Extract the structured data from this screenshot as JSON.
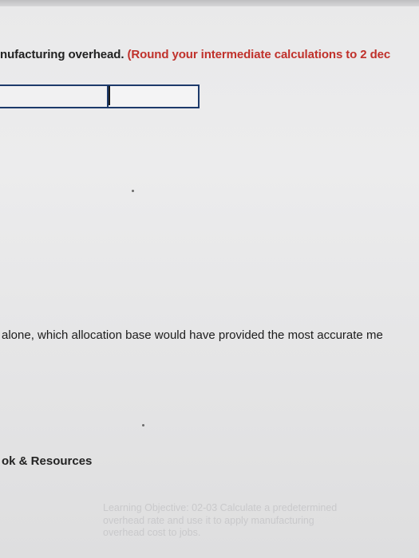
{
  "question": {
    "text_plain": "nufacturing overhead.",
    "text_red": "(Round your intermediate calculations to 2 dec"
  },
  "part_b": {
    "text": "alone, which allocation base would have provided the most accurate me"
  },
  "resources": {
    "label": "ok & Resources"
  },
  "learning_objective": {
    "text": "Learning Objective: 02-03 Calculate a predetermined overhead rate and use it to apply manufacturing overhead cost to jobs."
  },
  "colors": {
    "instruction_red": "#c0312b",
    "input_border": "#1d3a6b"
  }
}
